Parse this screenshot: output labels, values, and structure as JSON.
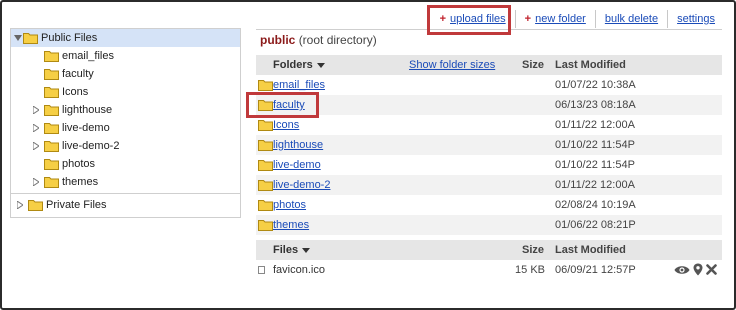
{
  "toolbar": {
    "upload_label": "upload files",
    "new_folder_label": "new folder",
    "bulk_delete_label": "bulk delete",
    "settings_label": "settings",
    "plus_glyph": "+"
  },
  "tree": {
    "items": [
      {
        "label": "Public Files",
        "expanded": true,
        "selected": true
      },
      {
        "label": "email_files"
      },
      {
        "label": "faculty"
      },
      {
        "label": "Icons"
      },
      {
        "label": "lighthouse",
        "expandable": true
      },
      {
        "label": "live-demo",
        "expandable": true
      },
      {
        "label": "live-demo-2",
        "expandable": true
      },
      {
        "label": "photos"
      },
      {
        "label": "themes",
        "expandable": true
      },
      {
        "label": "Private Files",
        "expandable": true
      }
    ]
  },
  "path": {
    "folder": "public",
    "note": "(root directory)"
  },
  "folders_header": {
    "name_label": "Folders",
    "size_link": "Show folder sizes",
    "size_label": "Size",
    "modified_label": "Last Modified"
  },
  "folders": [
    {
      "name": "email_files",
      "modified": "01/07/22 10:38A"
    },
    {
      "name": "faculty",
      "modified": "06/13/23 08:18A"
    },
    {
      "name": "Icons",
      "modified": "01/11/22 12:00A"
    },
    {
      "name": "lighthouse",
      "modified": "01/10/22 11:54P"
    },
    {
      "name": "live-demo",
      "modified": "01/10/22 11:54P"
    },
    {
      "name": "live-demo-2",
      "modified": "01/11/22 12:00A"
    },
    {
      "name": "photos",
      "modified": "02/08/24 10:19A"
    },
    {
      "name": "themes",
      "modified": "01/06/22 08:21P"
    }
  ],
  "files_header": {
    "name_label": "Files",
    "size_label": "Size",
    "modified_label": "Last Modified"
  },
  "files": [
    {
      "name": "favicon.ico",
      "size": "15 KB",
      "modified": "06/09/21 12:57P"
    }
  ],
  "colors": {
    "folder_fill": "#f6cf45",
    "folder_stroke": "#b08a12",
    "link": "#1a4bb8",
    "highlight": "#c0393b",
    "selected_row": "#d5e3f7"
  }
}
